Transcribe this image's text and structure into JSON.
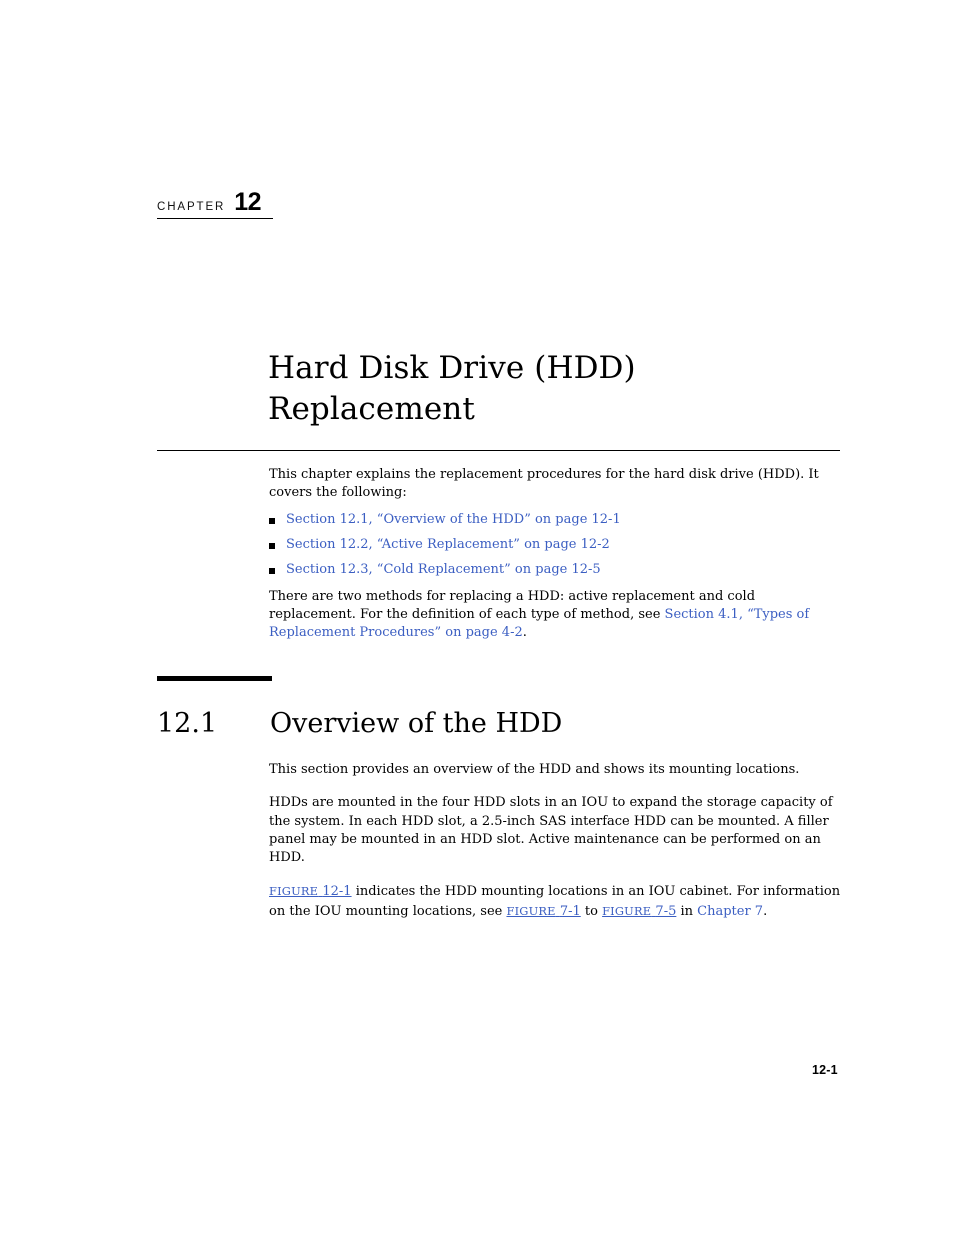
{
  "chapter": {
    "label": "CHAPTER",
    "number": "12",
    "title": "Hard Disk Drive (HDD) Replacement"
  },
  "intro": {
    "paragraph": "This chapter explains the replacement procedures for the hard disk drive (HDD). It covers the following:",
    "links": [
      {
        "text": "Section 12.1, “Overview of the HDD” on page 12-1"
      },
      {
        "text": "Section 12.2, “Active Replacement” on page 12-2"
      },
      {
        "text": "Section 12.3, “Cold Replacement” on page 12-5"
      }
    ],
    "methods_pre": "There are two methods for replacing a HDD: active replacement and cold replacement. For the definition of each type of method, see ",
    "methods_link": "Section 4.1, “Types of Replacement Procedures” on page 4-2",
    "methods_post": "."
  },
  "section": {
    "number": "12.1",
    "title": "Overview of the HDD",
    "paragraph1": "This section provides an overview of the HDD and shows its mounting locations.",
    "paragraph2": "HDDs are mounted in the four HDD slots in an IOU to expand the storage capacity of the system. In each HDD slot, a 2.5-inch SAS interface HDD can be mounted. A filler panel may be mounted in an HDD slot. Active maintenance can be performed on an HDD.",
    "figure_para": {
      "fig1_word": "FIGURE",
      "fig1_num": "12-1",
      "mid1": " indicates the HDD mounting locations in an IOU cabinet. For information on the IOU mounting locations, see ",
      "fig2_word": "FIGURE",
      "fig2_num": "7-1",
      "mid2": " to ",
      "fig3_word": "FIGURE",
      "fig3_num": "7-5",
      "mid3": " in ",
      "chapter_link": "Chapter 7",
      "end": "."
    }
  },
  "footer": {
    "page_number": "12-1"
  },
  "colors": {
    "link": "#3b5ec2",
    "text": "#000000",
    "background": "#ffffff"
  }
}
